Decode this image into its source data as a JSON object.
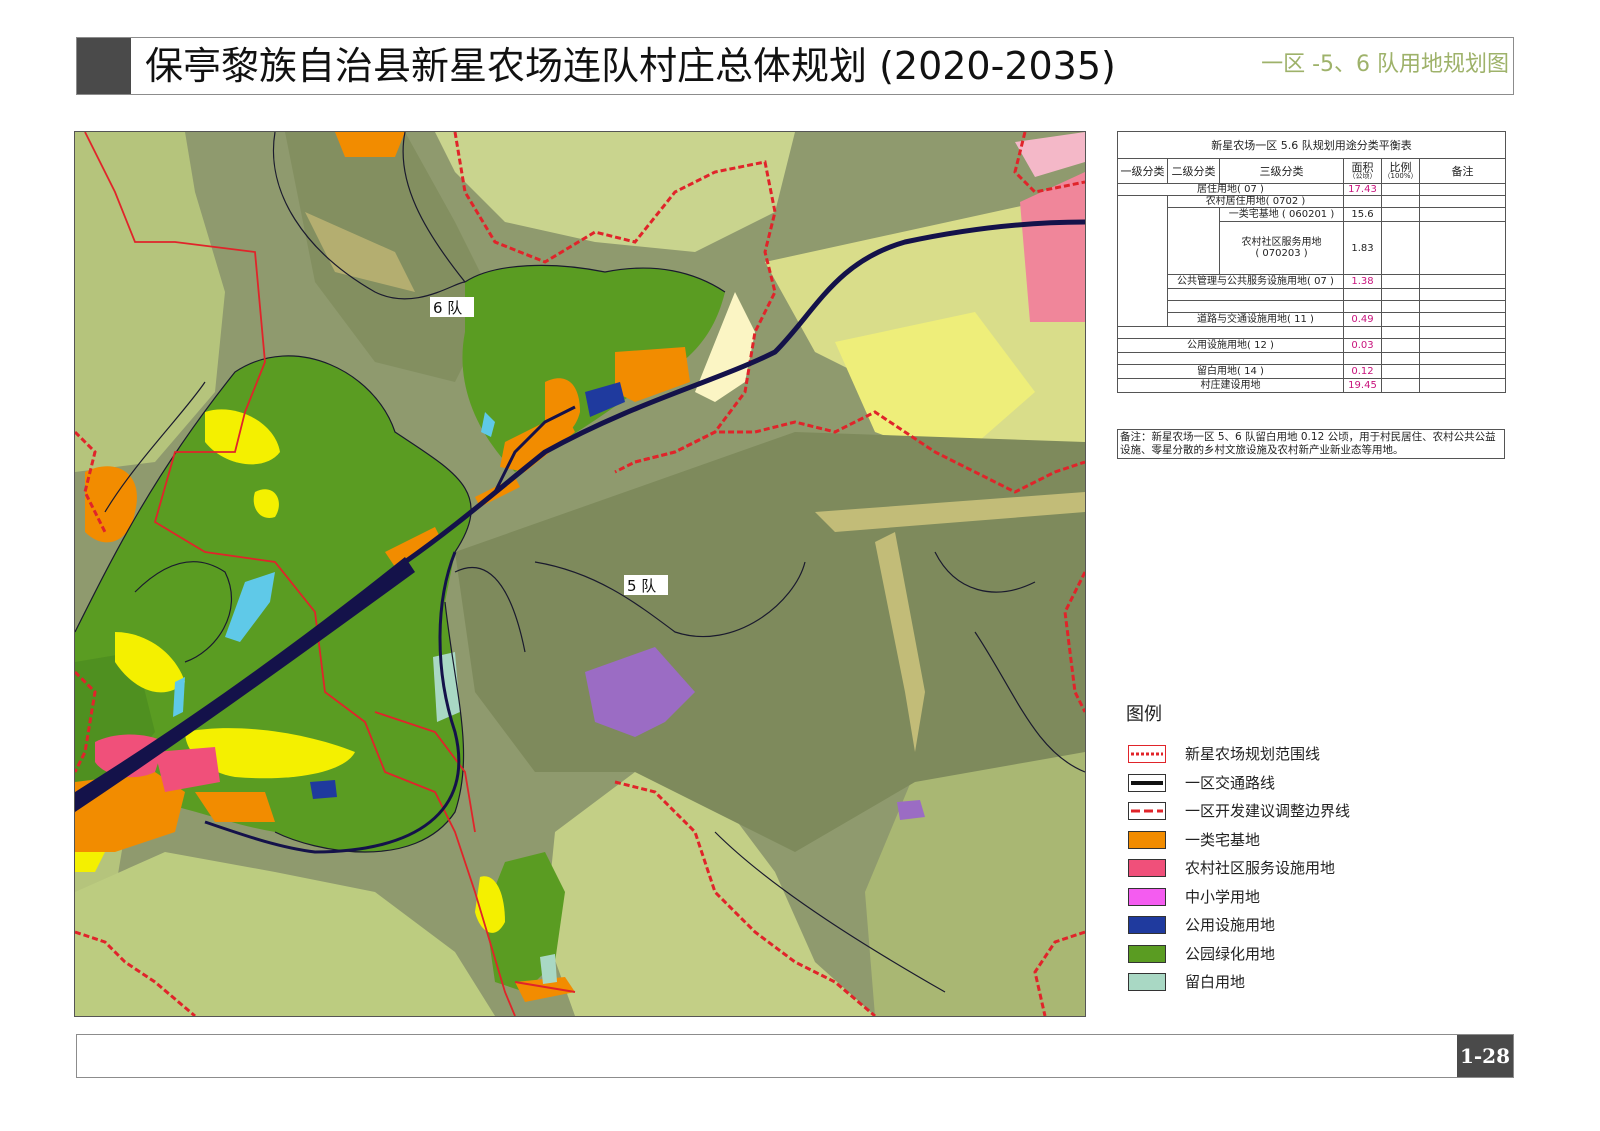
{
  "header": {
    "title": "保亭黎族自治县新星农场连队村庄总体规划 (2020-2035)",
    "subtitle": "一区 -5、6 队用地规划图"
  },
  "map": {
    "labels": {
      "team6": "6 队",
      "team5": "5 队"
    },
    "colors": {
      "background": "#8f9a6e",
      "forest": "#7f8c5c",
      "farmland": "#c7d28c",
      "light_green": "#a8bb6a",
      "park_green": "#5a9c22",
      "residential": "#f28c00",
      "service": "#f0507a",
      "public_utility": "#1f3a9e",
      "reserved": "#a9d8c4",
      "yellow": "#f4f000",
      "purple": "#9b6cc4",
      "water": "#5fc9e8",
      "road": "#14124a",
      "boundary_red": "#e0242a"
    }
  },
  "table": {
    "caption": "新星农场一区 5.6 队规划用途分类平衡表",
    "headers": {
      "level1": "一级分类",
      "level2": "二级分类",
      "level3": "三级分类",
      "area": "面积",
      "area_unit": "（公顷）",
      "ratio": "比例",
      "ratio_unit": "（100%）",
      "remarks": "备注"
    },
    "rows": {
      "residential": {
        "name": "居住用地( 07 )",
        "area": "17.43"
      },
      "rural_residential": {
        "name": "农村居住用地( 0702 )"
      },
      "homestead": {
        "name": "一类宅基地 ( 060201 )",
        "area": "15.6"
      },
      "community_service": {
        "name_line1": "农村社区服务用地",
        "name_line2": "( 070203 )",
        "area": "1.83"
      },
      "public_mgmt": {
        "name": "公共管理与公共服务设施用地( 07 )",
        "area": "1.38"
      },
      "road_transport": {
        "name": "道路与交通设施用地( 11 )",
        "area": "0.49"
      },
      "public_utility": {
        "name": "公用设施用地( 12 )",
        "area": "0.03"
      },
      "reserved": {
        "name": "留白用地( 14 )",
        "area": "0.12"
      },
      "village_construction": {
        "name": "村庄建设用地",
        "area": "19.45"
      }
    },
    "note": "备注：新星农场一区 5、6 队留白用地 0.12 公顷，用于村民居住、农村公共公益设施、零星分散的乡村文旅设施及农村新产业新业态等用地。"
  },
  "legend": {
    "title": "图例",
    "items": [
      {
        "label": "新星农场规划范围线",
        "swatch": "dotted-red-line"
      },
      {
        "label": "一区交通路线",
        "swatch": "black-line"
      },
      {
        "label": "一区开发建议调整边界线",
        "swatch": "dashed-red-line"
      },
      {
        "label": "一类宅基地",
        "color": "#f28c00"
      },
      {
        "label": "农村社区服务设施用地",
        "color": "#f0507a"
      },
      {
        "label": "中小学用地",
        "color": "#f45cf0"
      },
      {
        "label": "公用设施用地",
        "color": "#1f3a9e"
      },
      {
        "label": "公园绿化用地",
        "color": "#5a9c22"
      },
      {
        "label": "留白用地",
        "color": "#a9d8c4"
      }
    ]
  },
  "footer": {
    "page_number": "1-28"
  }
}
